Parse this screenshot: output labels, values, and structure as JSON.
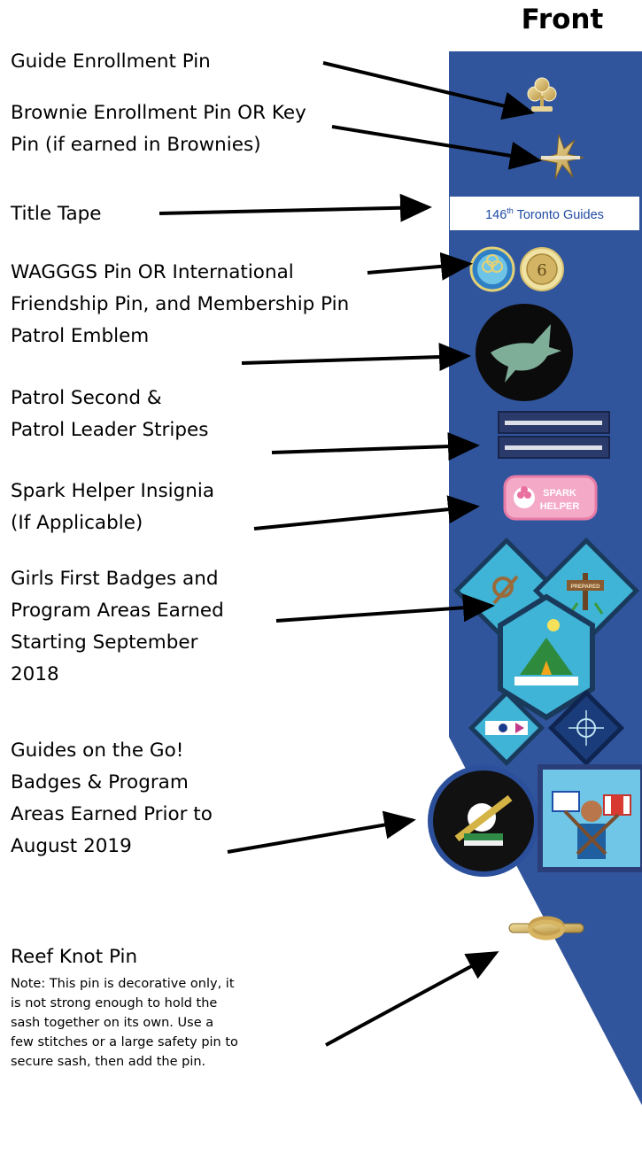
{
  "heading": "Front",
  "labels": {
    "guide_enrollment": "Guide Enrollment Pin",
    "brownie_enrollment": [
      "Brownie Enrollment Pin OR Key",
      "Pin (if earned in Brownies)"
    ],
    "title_tape": "Title Tape",
    "wagggs": [
      "WAGGGS Pin OR International",
      "Friendship Pin, and Membership Pin"
    ],
    "patrol_emblem": "Patrol Emblem",
    "patrol_stripes": [
      "Patrol Second &",
      "Patrol Leader Stripes"
    ],
    "spark_helper": [
      "Spark Helper Insignia",
      "(If Applicable)"
    ],
    "girls_first": [
      "Girls First Badges and",
      "Program Areas Earned",
      "Starting September",
      "2018"
    ],
    "guides_on_the_go": [
      "Guides on the Go!",
      "Badges & Program",
      "Areas Earned Prior to",
      "August 2019"
    ],
    "reef_knot": "Reef Knot Pin"
  },
  "note": [
    "Note: This pin is decorative only, it",
    "is not strong enough to hold the",
    "sash together on its own.  Use a",
    "few stitches or a large safety pin to",
    "secure sash, then add the pin."
  ],
  "sash": {
    "title_tape_num": "146",
    "title_tape_sup": "th",
    "title_tape_rest": " Toronto Guides",
    "spark_badge_line1": "SPARK",
    "spark_badge_line2": "HELPER",
    "pinned_label": "PREPARED",
    "membership_number": "6"
  },
  "colors": {
    "sash_blue": "#31559c",
    "tape_text": "#1f4aa3",
    "badge_teal": "#3fb4d6",
    "pin_gold": "#d3b465"
  }
}
